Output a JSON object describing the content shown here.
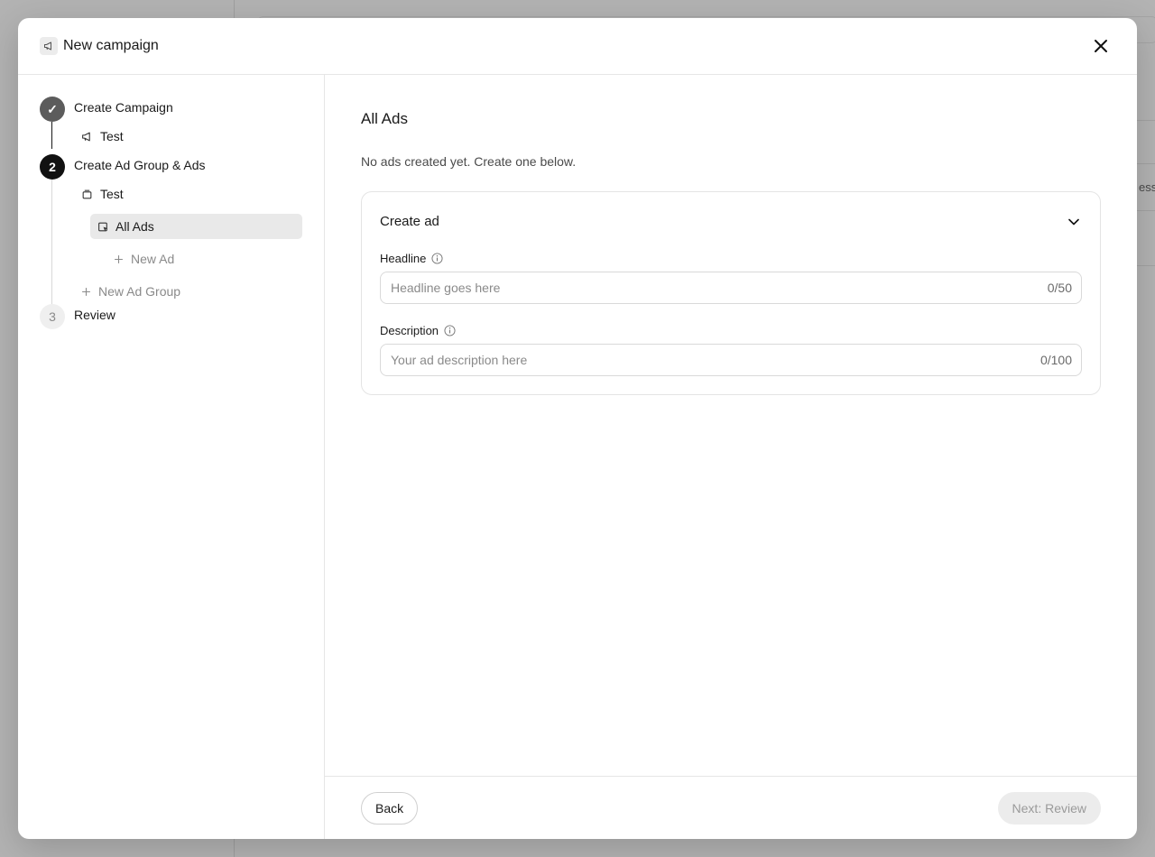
{
  "background": {
    "table_header_fragment": "essi"
  },
  "modal": {
    "title": "New campaign",
    "close_icon": "close-icon"
  },
  "steps": [
    {
      "number": "✓",
      "label": "Create Campaign",
      "state": "done"
    },
    {
      "number": "2",
      "label": "Create Ad Group & Ads",
      "state": "active"
    },
    {
      "number": "3",
      "label": "Review",
      "state": "pending"
    }
  ],
  "tree": {
    "campaign_name": "Test",
    "ad_group_name": "Test",
    "selected_item": "All Ads",
    "new_ad": "New Ad",
    "new_ad_group": "New Ad Group"
  },
  "content": {
    "title": "All Ads",
    "subtitle": "No ads created yet. Create one below.",
    "card": {
      "title": "Create ad",
      "headline": {
        "label": "Headline",
        "placeholder": "Headline goes here",
        "value": "",
        "counter": "0/50"
      },
      "description": {
        "label": "Description",
        "placeholder": "Your ad description here",
        "value": "",
        "counter": "0/100"
      }
    }
  },
  "footer": {
    "back_label": "Back",
    "next_label": "Next: Review"
  }
}
